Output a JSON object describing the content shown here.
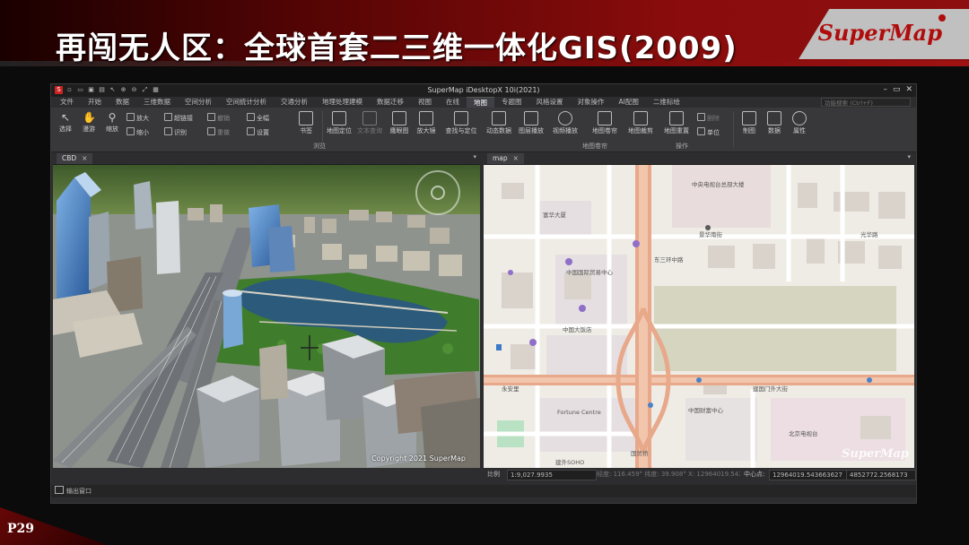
{
  "slide": {
    "title": "再闯无人区：全球首套二三维一体化GIS(2009)",
    "logo": "SuperMap",
    "page_number": "P29",
    "colors": {
      "band_red": "#8a0c0c",
      "logo_red": "#b00c0c"
    }
  },
  "window": {
    "title": "SuperMap iDesktopX 10i(2021)",
    "controls": [
      "–",
      "▭",
      "✕"
    ]
  },
  "menu": {
    "items": [
      "文件",
      "开始",
      "数据",
      "三维数据",
      "空间分析",
      "空间统计分析",
      "交通分析",
      "地理处理建模",
      "数据迁移",
      "视图",
      "在线",
      "地图",
      "专题图",
      "风格设置",
      "对象操作",
      "AI配图",
      "二维标绘"
    ],
    "active_index": 11,
    "search_placeholder": "功能搜索 (Ctrl+F)"
  },
  "ribbon": {
    "browse": {
      "label": "浏览",
      "select": "选择",
      "pan": "漫游",
      "zoom": "缩放",
      "zoom_in": "放大",
      "zoom_out": "缩小",
      "hyperlink": "超链接",
      "identify": "识别",
      "undo": "撤销",
      "redo": "重做",
      "full_extent": "全幅",
      "settings": "设置",
      "bookmark": "书签"
    },
    "map_tools": {
      "label": "地图卷帘",
      "items": [
        "地图定位",
        "文本查询",
        "鹰眼图",
        "放大镜",
        "查找与定位",
        "动态数据",
        "图层播放",
        "视频播放",
        "地图卷帘",
        "地图裁剪",
        "地图重置"
      ]
    },
    "operate": {
      "label": "操作",
      "delete": "删除",
      "unit": "单位"
    },
    "right_group": [
      "制图",
      "数据",
      "属性"
    ]
  },
  "panes": {
    "left": {
      "tab": "CBD",
      "copyright": "Copyright 2021 SuperMap"
    },
    "right": {
      "tab": "map",
      "watermark": "SuperMap",
      "labels": {
        "cctv": "中央电视台总部大楼",
        "world_trade": "中国国际贸易中心",
        "china_world_hotel": "中国大饭店",
        "fortune": "Fortune Centre",
        "guomao_bridge": "国贸桥",
        "jianwai_soho": "建外SOHO",
        "beijing_tv": "北京电视台",
        "jianguomenwai": "建国门外大街",
        "guanghua": "光华路",
        "jingsheng": "景华南街",
        "yonganli": "永安里",
        "east_third_ring": "东三环中路",
        "fuhua": "富华大厦",
        "zhongguo_caifu": "中国财富中心"
      }
    }
  },
  "statusbar": {
    "scale_label": "比例",
    "scale_value": "1:9,027.9935",
    "coords": "经度: 116.459°  纬度: 39.908°  X: 12964019.543663627",
    "center_label": "中心点:",
    "center_x": "12964019.543663627",
    "center_y": "4852772.2568173"
  },
  "output": {
    "label": "输出窗口"
  }
}
